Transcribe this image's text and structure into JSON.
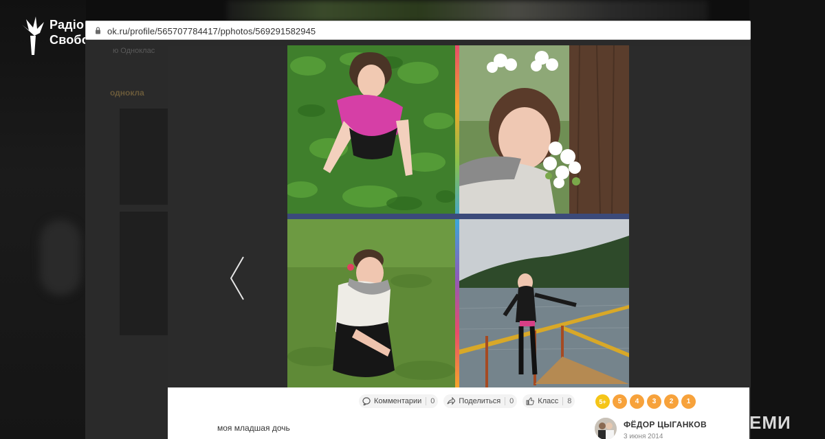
{
  "broadcaster": {
    "logo_line1": "Радіо",
    "logo_line2": "Свобода"
  },
  "browser": {
    "url": "ok.ru/profile/565707784417/pphotos/569291582945"
  },
  "underlying_page": {
    "nav_text": "ю   Одноклас",
    "site_label": "однокла"
  },
  "photo_viewer": {
    "actions": [
      {
        "label": "Комментарии",
        "count": "0",
        "icon": "comment-icon"
      },
      {
        "label": "Поделиться",
        "count": "0",
        "icon": "share-icon"
      },
      {
        "label": "Класс",
        "count": "8",
        "icon": "like-icon"
      }
    ],
    "ratings": [
      "5+",
      "5",
      "4",
      "3",
      "2",
      "1"
    ],
    "caption": "моя младшая дочь",
    "author": {
      "name": "ФЁДОР ЦЫГАНКОВ",
      "date": "3 июня 2014"
    }
  },
  "corner_watermark": "ЕМИ",
  "colors": {
    "rating_orange": "#f7a23b",
    "rating_plus": "#f5c518",
    "panel_bg": "#ffffff",
    "overlay_bg": "#2b2b2b"
  }
}
